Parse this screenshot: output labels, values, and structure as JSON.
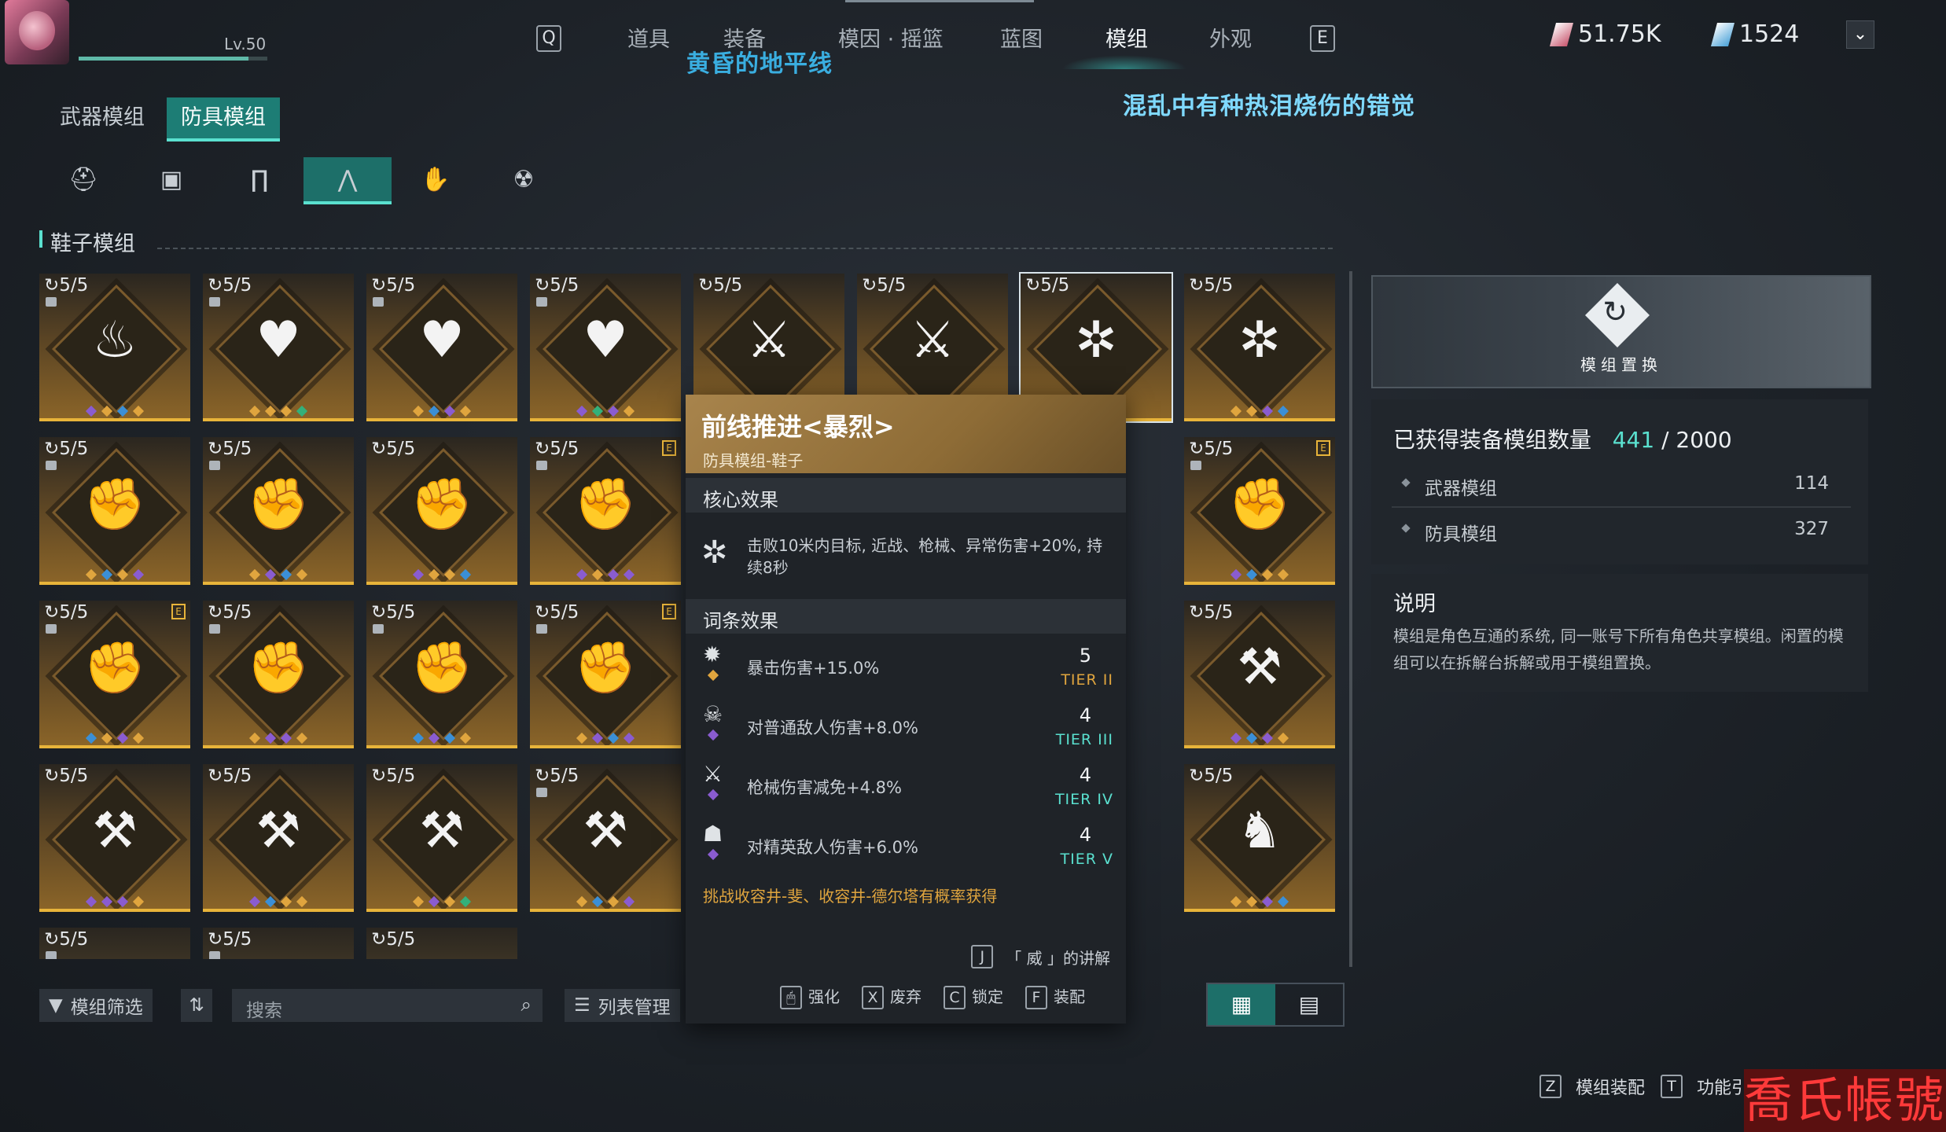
{
  "player": {
    "level": "Lv.50",
    "xp_fraction": 0.9
  },
  "nav": {
    "prev_key": "Q",
    "next_key": "E",
    "tabs": [
      "道具",
      "装备",
      "模因 · 摇篮",
      "蓝图",
      "模组",
      "外观"
    ],
    "active_tab": "模组",
    "subtitle_left": "黄昏的地平线",
    "subtitle_right": "混乱中有种热泪烧伤的错觉"
  },
  "currency": [
    {
      "value": "51.75K",
      "color": "#c8566e"
    },
    {
      "value": "1524",
      "color": "#4aa2d8"
    }
  ],
  "category_tabs": [
    "武器模组",
    "防具模组"
  ],
  "active_category": "防具模组",
  "slots": [
    {
      "icon": "helmet-icon",
      "glyph": "⛑"
    },
    {
      "icon": "armor-icon",
      "glyph": "▣"
    },
    {
      "icon": "pants-icon",
      "glyph": "∏"
    },
    {
      "icon": "boots-icon",
      "glyph": "⋀"
    },
    {
      "icon": "gloves-icon",
      "glyph": "✋"
    },
    {
      "icon": "mask-icon",
      "glyph": "☢"
    }
  ],
  "active_slot": 3,
  "section_title": "鞋子模组",
  "colors": {
    "gold": "#e0a53e",
    "blue": "#3b8fd6",
    "purple": "#8a5cd0",
    "green": "#33b07a",
    "accent": "#5ae0cf"
  },
  "grid": {
    "rows": [
      [
        {
          "count": "5/5",
          "lock": true,
          "e": false,
          "icon": "flame-star-icon",
          "glyph": "♨",
          "dots": [
            "purple",
            "gold",
            "blue",
            "gold"
          ]
        },
        {
          "count": "5/5",
          "lock": true,
          "e": false,
          "icon": "heart-star-icon",
          "glyph": "♥",
          "dots": [
            "gold",
            "gold",
            "gold",
            "green"
          ]
        },
        {
          "count": "5/5",
          "lock": true,
          "e": false,
          "icon": "heart-star-icon",
          "glyph": "♥",
          "dots": [
            "gold",
            "blue",
            "purple",
            "gold"
          ]
        },
        {
          "count": "5/5",
          "lock": true,
          "e": false,
          "icon": "heart-star-icon",
          "glyph": "♥",
          "dots": [
            "purple",
            "green",
            "purple",
            "gold"
          ]
        },
        {
          "count": "5/5",
          "lock": false,
          "e": false,
          "icon": "rifleman-star-icon",
          "glyph": "⚔",
          "dots": [
            "gold",
            "gold",
            "gold",
            "gold"
          ]
        },
        {
          "count": "5/5",
          "lock": false,
          "e": false,
          "icon": "rifleman-star-icon",
          "glyph": "⚔",
          "dots": [
            "gold",
            "gold",
            "gold",
            "gold"
          ]
        },
        {
          "count": "5/5",
          "lock": false,
          "e": false,
          "icon": "burst-star-icon",
          "glyph": "✲",
          "dots": [
            "gold",
            "gold",
            "gold",
            "purple"
          ],
          "selected": true
        },
        {
          "count": "5/5",
          "lock": false,
          "e": false,
          "icon": "burst-star-icon",
          "glyph": "✲",
          "dots": [
            "gold",
            "gold",
            "purple",
            "blue"
          ]
        }
      ],
      [
        {
          "count": "5/5",
          "lock": true,
          "e": false,
          "icon": "fire-fist-icon",
          "glyph": "✊",
          "dots": [
            "gold",
            "blue",
            "gold",
            "purple"
          ]
        },
        {
          "count": "5/5",
          "lock": true,
          "e": false,
          "icon": "fire-fist-icon",
          "glyph": "✊",
          "dots": [
            "gold",
            "purple",
            "blue",
            "gold"
          ]
        },
        {
          "count": "5/5",
          "lock": false,
          "e": false,
          "icon": "fire-fist-icon",
          "glyph": "✊",
          "dots": [
            "purple",
            "gold",
            "gold",
            "blue"
          ]
        },
        {
          "count": "5/5",
          "lock": true,
          "e": true,
          "icon": "fire-fist-icon",
          "glyph": "✊",
          "dots": [
            "purple",
            "gold",
            "purple",
            "purple"
          ]
        },
        null,
        null,
        null,
        {
          "count": "5/5",
          "lock": true,
          "e": true,
          "icon": "fire-fist-icon",
          "glyph": "✊",
          "dots": [
            "purple",
            "blue",
            "gold",
            "gold"
          ]
        }
      ],
      [
        {
          "count": "5/5",
          "lock": true,
          "e": true,
          "icon": "fire-fist-icon",
          "glyph": "✊",
          "dots": [
            "blue",
            "gold",
            "purple",
            "gold"
          ]
        },
        {
          "count": "5/5",
          "lock": true,
          "e": false,
          "icon": "fire-fist-icon",
          "glyph": "✊",
          "dots": [
            "gold",
            "purple",
            "purple",
            "gold"
          ]
        },
        {
          "count": "5/5",
          "lock": true,
          "e": false,
          "icon": "fire-fist-icon",
          "glyph": "✊",
          "dots": [
            "blue",
            "purple",
            "blue",
            "gold"
          ]
        },
        {
          "count": "5/5",
          "lock": true,
          "e": true,
          "icon": "fire-fist-icon",
          "glyph": "✊",
          "dots": [
            "gold",
            "purple",
            "blue",
            "purple"
          ]
        },
        null,
        null,
        null,
        {
          "count": "5/5",
          "lock": false,
          "e": false,
          "icon": "claw-ammo-icon",
          "glyph": "⚒",
          "dots": [
            "purple",
            "blue",
            "purple",
            "gold"
          ]
        }
      ],
      [
        {
          "count": "5/5",
          "lock": false,
          "e": false,
          "icon": "claw-ammo-icon",
          "glyph": "⚒",
          "dots": [
            "purple",
            "purple",
            "purple",
            "gold"
          ]
        },
        {
          "count": "5/5",
          "lock": false,
          "e": false,
          "icon": "claw-ammo-icon",
          "glyph": "⚒",
          "dots": [
            "purple",
            "blue",
            "gold",
            "gold"
          ]
        },
        {
          "count": "5/5",
          "lock": false,
          "e": false,
          "icon": "claw-ammo-icon",
          "glyph": "⚒",
          "dots": [
            "gold",
            "purple",
            "gold",
            "green"
          ]
        },
        {
          "count": "5/5",
          "lock": true,
          "e": false,
          "icon": "claw-ammo-icon",
          "glyph": "⚒",
          "dots": [
            "gold",
            "blue",
            "gold",
            "purple"
          ]
        },
        null,
        null,
        null,
        {
          "count": "5/5",
          "lock": false,
          "e": false,
          "icon": "muscle-icon",
          "glyph": "♞",
          "dots": [
            "gold",
            "gold",
            "purple",
            "blue"
          ]
        }
      ],
      [
        {
          "count": "5/5",
          "lock": true,
          "partial": true
        },
        {
          "count": "5/5",
          "lock": true,
          "partial": true
        },
        {
          "count": "5/5",
          "lock": false,
          "partial": true
        }
      ]
    ]
  },
  "toolbar": {
    "filter_label": "模组筛选",
    "sort_glyph": "⇅",
    "search_placeholder": "搜索",
    "list_manage_label": "列表管理"
  },
  "tooltip": {
    "title": "前线推进<暴烈>",
    "type": "防具模组-鞋子",
    "core_header": "核心效果",
    "core_text": "击败10米内目标, 近战、枪械、异常伤害+20%, 持续8秒",
    "affix_header": "词条效果",
    "affixes": [
      {
        "icon": "crit-damage-icon",
        "glyph": "✹",
        "dot": "gold",
        "text": "暴击伤害+15.0%",
        "value": "5",
        "tier": "TIER II",
        "tier_color": "#e0a53e"
      },
      {
        "icon": "normal-enemy-icon",
        "glyph": "☠",
        "dot": "purple",
        "text": "对普通敌人伤害+8.0%",
        "value": "4",
        "tier": "TIER III",
        "tier_color": "#5ae0cf"
      },
      {
        "icon": "gun-resist-icon",
        "glyph": "⚔",
        "dot": "purple",
        "text": "枪械伤害减免+4.8%",
        "value": "4",
        "tier": "TIER IV",
        "tier_color": "#5ae0cf"
      },
      {
        "icon": "elite-enemy-icon",
        "glyph": "☗",
        "dot": "purple",
        "text": "对精英敌人伤害+6.0%",
        "value": "4",
        "tier": "TIER V",
        "tier_color": "#5ae0cf"
      }
    ],
    "source": "挑战收容井-斐、收容井-德尔塔有概率获得",
    "explain_key": "J",
    "explain_label": "「 威 」的讲解",
    "actions": [
      {
        "key": "🖱",
        "label": "强化"
      },
      {
        "key": "X",
        "label": "废弃"
      },
      {
        "key": "C",
        "label": "锁定"
      },
      {
        "key": "F",
        "label": "装配"
      }
    ]
  },
  "banner": {
    "label": "模组置换"
  },
  "stats": {
    "title": "已获得装备模组数量",
    "current": "441",
    "total": "/ 2000",
    "rows": [
      {
        "label": "武器模组",
        "value": "114"
      },
      {
        "label": "防具模组",
        "value": "327"
      }
    ]
  },
  "description": {
    "title": "说明",
    "text": "模组是角色互通的系统, 同一账号下所有角色共享模组。闲置的模组可以在拆解台拆解或用于模组置换。"
  },
  "footer": [
    {
      "key": "Z",
      "label": "模组装配"
    },
    {
      "key": "T",
      "label": "功能引"
    }
  ],
  "watermark": "喬氏帳號"
}
